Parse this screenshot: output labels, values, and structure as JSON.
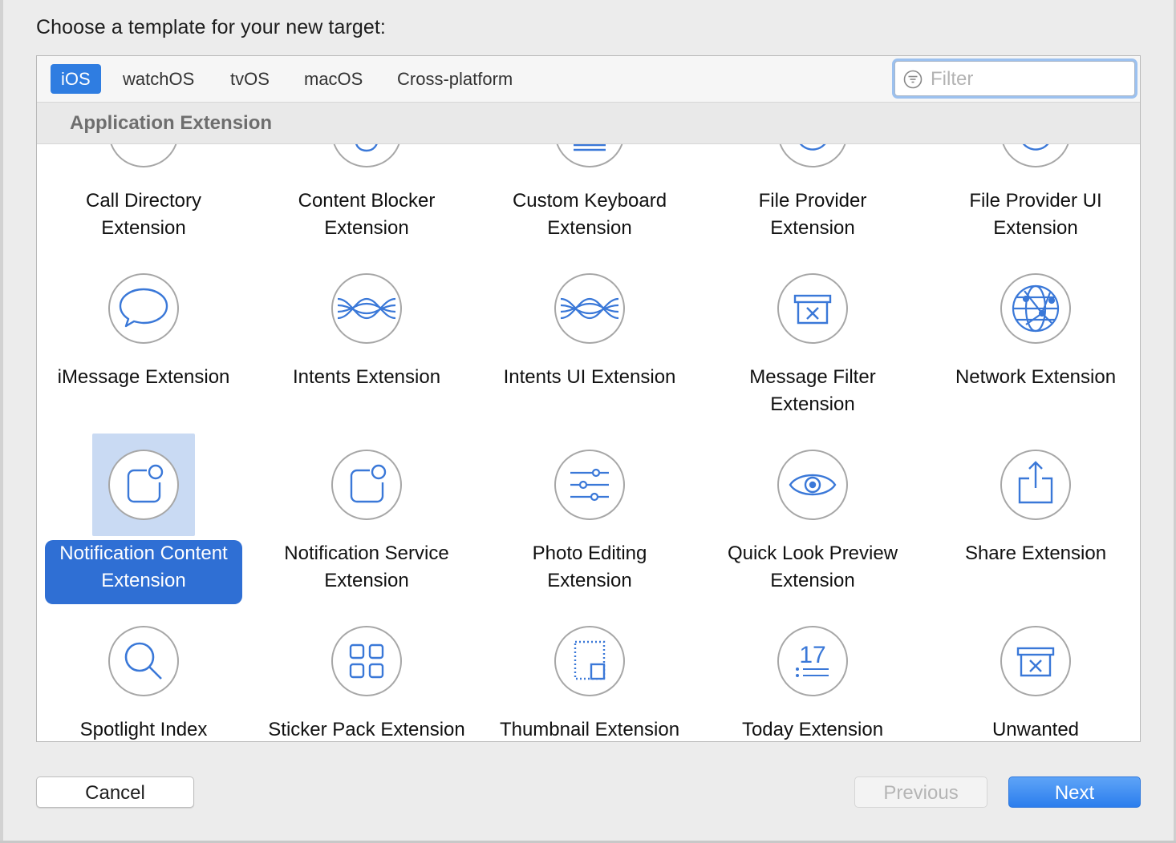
{
  "dialog": {
    "prompt": "Choose a template for your new target:",
    "filter_placeholder": "Filter",
    "section_title": "Application Extension"
  },
  "tabs": [
    {
      "label": "iOS",
      "active": true
    },
    {
      "label": "watchOS"
    },
    {
      "label": "tvOS"
    },
    {
      "label": "macOS"
    },
    {
      "label": "Cross-platform"
    }
  ],
  "templates": [
    {
      "label": "Call Directory Extension",
      "icon": "phone-icon"
    },
    {
      "label": "Content Blocker Extension",
      "icon": "hand-icon"
    },
    {
      "label": "Custom Keyboard Extension",
      "icon": "keyboard-icon"
    },
    {
      "label": "File Provider Extension",
      "icon": "refresh-icon"
    },
    {
      "label": "File Provider UI Extension",
      "icon": "refresh-icon"
    },
    {
      "label": "iMessage Extension",
      "icon": "message-bubble-icon"
    },
    {
      "label": "Intents Extension",
      "icon": "intents-waves-icon"
    },
    {
      "label": "Intents UI Extension",
      "icon": "intents-waves-icon"
    },
    {
      "label": "Message Filter Extension",
      "icon": "filter-box-icon"
    },
    {
      "label": "Network Extension",
      "icon": "network-globe-icon"
    },
    {
      "label": "Notification Content Extension",
      "icon": "notification-icon",
      "selected": true
    },
    {
      "label": "Notification Service Extension",
      "icon": "notification-icon"
    },
    {
      "label": "Photo Editing Extension",
      "icon": "sliders-icon"
    },
    {
      "label": "Quick Look Preview Extension",
      "icon": "eye-icon"
    },
    {
      "label": "Share Extension",
      "icon": "share-icon"
    },
    {
      "label": "Spotlight Index Extension",
      "icon": "magnifier-icon"
    },
    {
      "label": "Sticker Pack Extension",
      "icon": "sticker-grid-icon"
    },
    {
      "label": "Thumbnail Extension",
      "icon": "thumbnail-icon"
    },
    {
      "label": "Today Extension",
      "icon": "today-calendar-icon"
    },
    {
      "label": "Unwanted Communication Extension",
      "icon": "filter-box-icon"
    }
  ],
  "buttons": {
    "cancel": "Cancel",
    "previous": "Previous",
    "next": "Next"
  },
  "colors": {
    "accent": "#2f7de1",
    "selection_label": "#2f6fd4",
    "selection_icon_bg": "#c9daf3",
    "icon_stroke": "#3a78d8"
  }
}
